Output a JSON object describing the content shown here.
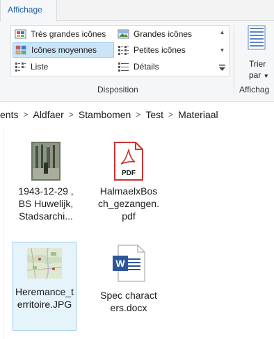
{
  "ribbon": {
    "active_tab": "Affichage",
    "layout_items": [
      {
        "label": "Très grandes icônes",
        "icon": "extra-large-icons-icon"
      },
      {
        "label": "Grandes icônes",
        "icon": "large-icons-icon"
      },
      {
        "label": "Icônes moyennes",
        "icon": "medium-icons-icon",
        "selected": true
      },
      {
        "label": "Petites icônes",
        "icon": "small-icons-icon"
      },
      {
        "label": "Liste",
        "icon": "list-icon"
      },
      {
        "label": "Détails",
        "icon": "details-icon"
      }
    ],
    "layout_group_label": "Disposition",
    "sort_label_line1": "Trier",
    "sort_label_line2": "par",
    "view_group_label": "Affichag"
  },
  "breadcrumb": [
    "ents",
    "Aldfaer",
    "Stambomen",
    "Test",
    "Materiaal"
  ],
  "files": [
    {
      "name": "1943-12-29 , BS Huwelijk, Stadsarchi...",
      "type": "photo"
    },
    {
      "name": "HalmaelxBosch_gezangen.pdf",
      "type": "pdf",
      "badge": "PDF"
    },
    {
      "name": "Heremance_territoire.JPG",
      "type": "map",
      "selected": true
    },
    {
      "name": "Spec characters.docx",
      "type": "word",
      "badge": "W"
    }
  ],
  "colors": {
    "accent": "#1e5fa9",
    "selection": "#cce4f7",
    "pdf_red": "#d32f2f",
    "word_blue": "#2b579a"
  }
}
